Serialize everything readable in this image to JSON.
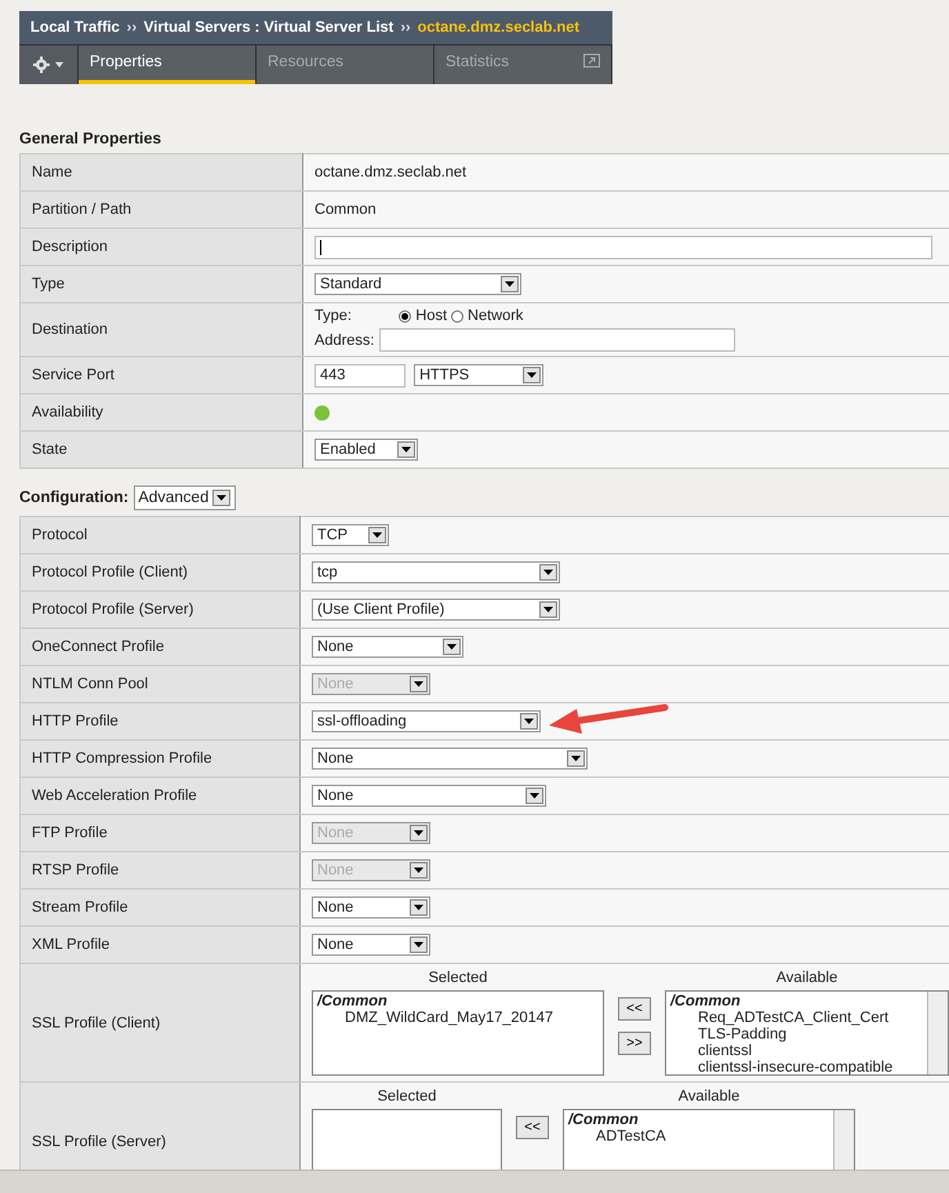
{
  "breadcrumb": [
    {
      "text": "Local Traffic",
      "current": false
    },
    {
      "prefix": "››",
      "text": "Virtual Servers : Virtual Server List",
      "current": false
    },
    {
      "prefix": "››",
      "text": "octane.dmz.seclab.net",
      "current": true
    }
  ],
  "tabs": [
    {
      "label": "Properties",
      "selected": true,
      "kind": "plain"
    },
    {
      "label": "Resources",
      "selected": false,
      "kind": "plain"
    },
    {
      "label": "Statistics",
      "selected": false,
      "kind": "popout"
    }
  ],
  "sections": [
    {
      "title": "General Properties",
      "rows": [
        {
          "label": "Name",
          "kind": "text",
          "value": "octane.dmz.seclab.net"
        },
        {
          "label": "Partition / Path",
          "kind": "text",
          "value": "Common"
        },
        {
          "label": "Description",
          "kind": "input"
        },
        {
          "label": "Type",
          "kind": "select",
          "value": "Standard",
          "disabled": false
        },
        {
          "label": "Destination",
          "kind": "destination",
          "type_label": "Type:",
          "options": [
            {
              "label": "Host",
              "selected": true
            },
            {
              "label": "Network",
              "selected": false
            }
          ],
          "address_label": "Address:"
        },
        {
          "label": "Service Port",
          "kind": "port",
          "port": "443",
          "service": "HTTPS"
        },
        {
          "label": "Availability",
          "kind": "status",
          "color": "#7cc33a"
        },
        {
          "label": "State",
          "kind": "select",
          "value": "Enabled",
          "disabled": false
        }
      ]
    },
    {
      "title": "Configuration:",
      "mode": "Advanced",
      "rows": [
        {
          "label": "Protocol",
          "kind": "select",
          "value": "TCP",
          "disabled": false
        },
        {
          "label": "Protocol Profile (Client)",
          "kind": "select",
          "value": "tcp",
          "disabled": false
        },
        {
          "label": "Protocol Profile (Server)",
          "kind": "select",
          "value": "(Use Client Profile)",
          "disabled": false
        },
        {
          "label": "OneConnect Profile",
          "kind": "select",
          "value": "None",
          "disabled": false
        },
        {
          "label": "NTLM Conn Pool",
          "kind": "select",
          "value": "None",
          "disabled": true
        },
        {
          "label": "HTTP Profile",
          "kind": "select",
          "value": "ssl-offloading",
          "disabled": false,
          "arrow": true
        },
        {
          "label": "HTTP Compression Profile",
          "kind": "select",
          "value": "None",
          "disabled": false
        },
        {
          "label": "Web Acceleration Profile",
          "kind": "select",
          "value": "None",
          "disabled": false
        },
        {
          "label": "FTP Profile",
          "kind": "select",
          "value": "None",
          "disabled": true
        },
        {
          "label": "RTSP Profile",
          "kind": "select",
          "value": "None",
          "disabled": true
        },
        {
          "label": "Stream Profile",
          "kind": "select",
          "value": "None",
          "disabled": false
        },
        {
          "label": "XML Profile",
          "kind": "select",
          "value": "None",
          "disabled": false
        },
        {
          "label": "SSL Profile (Client)",
          "kind": "dual_list",
          "selected_label": "Selected",
          "available_label": "Available",
          "selected": {
            "group": "/Common",
            "items": [
              "DMZ_WildCard_May17_20147"
            ]
          },
          "buttons": [
            "<<",
            ">>"
          ],
          "available": {
            "group": "/Common",
            "items": [
              "Req_ADTestCA_Client_Cert",
              "TLS-Padding",
              "clientssl",
              "clientssl-insecure-compatible"
            ]
          }
        },
        {
          "label": "SSL Profile (Server)",
          "kind": "dual_list",
          "selected_label": "Selected",
          "available_label": "Available",
          "selected": {},
          "buttons": [
            "<<"
          ],
          "available": {
            "group": "/Common",
            "items": [
              "ADTestCA"
            ]
          }
        }
      ]
    }
  ]
}
